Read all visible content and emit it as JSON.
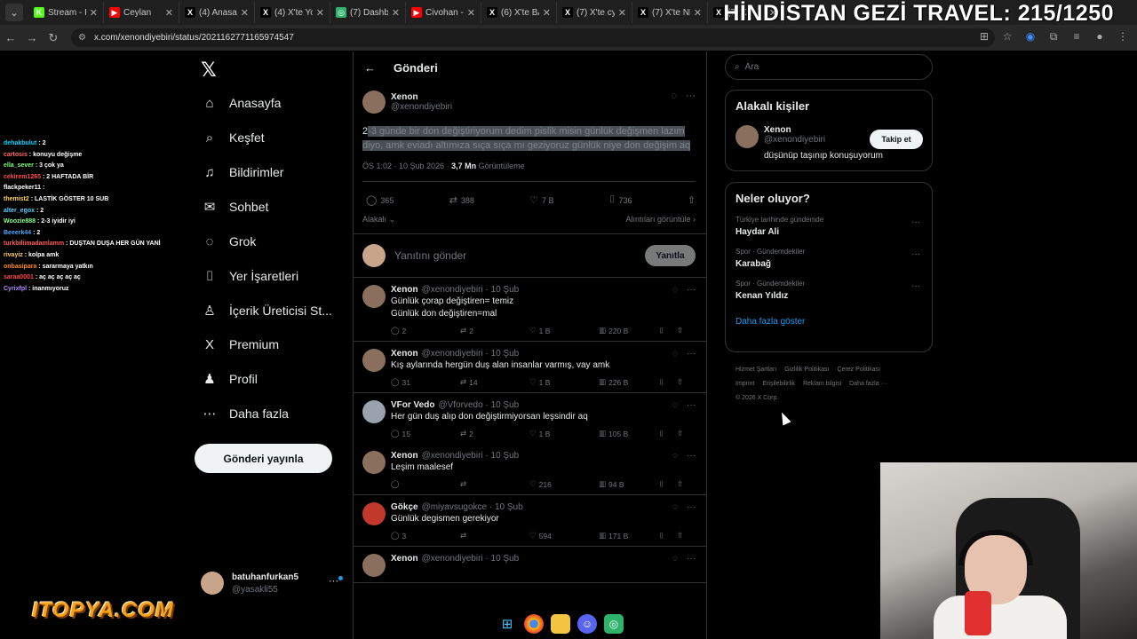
{
  "browser": {
    "tabs": [
      {
        "title": "Stream - K",
        "icon": "K",
        "color": "#53fc18"
      },
      {
        "title": "Ceylan",
        "icon": "▶",
        "color": "#ff0000"
      },
      {
        "title": "(4) Anasay",
        "icon": "X",
        "color": "#000000"
      },
      {
        "title": "(4) X'te Yo",
        "icon": "X",
        "color": "#000000"
      },
      {
        "title": "(7) Dashbo",
        "icon": "◎",
        "color": "#2fb36b"
      },
      {
        "title": "Civohan -",
        "icon": "▶",
        "color": "#ff0000"
      },
      {
        "title": "(6) X'te BA",
        "icon": "X",
        "color": "#000000"
      },
      {
        "title": "(7) X'te cy",
        "icon": "X",
        "color": "#000000"
      },
      {
        "title": "(7) X'te NE",
        "icon": "X",
        "color": "#000000"
      },
      {
        "title": "(7) X",
        "icon": "X",
        "color": "#000000"
      }
    ],
    "url": "x.com/xenondiyebiri/status/2021162771165974547"
  },
  "overlay_title": "HİNDİSTAN GEZİ TRAVEL: 215/1250",
  "chat": [
    {
      "user": "dehakbulut",
      "msg": "2",
      "color": "#00d4ff"
    },
    {
      "user": "cartosis",
      "msg": "konuyu değişme",
      "color": "#ff6b6b"
    },
    {
      "user": "ella_sever",
      "msg": "3 çok ya",
      "color": "#7cff7c"
    },
    {
      "user": "cekirem1265",
      "msg": "2 HAFTADA BİR",
      "color": "#ff4d4d"
    },
    {
      "user": "flackpeker11",
      "msg": "",
      "color": "#ffffff"
    },
    {
      "user": "themist2",
      "msg": "LASTİK GÖSTER 10 SUB",
      "color": "#ffd24d"
    },
    {
      "user": "alter_egox",
      "msg": "2",
      "color": "#66ccff"
    },
    {
      "user": "Woozie888",
      "msg": "2-3 iyidir iyi",
      "color": "#8cff8c"
    },
    {
      "user": "Beeerk44",
      "msg": "2",
      "color": "#4da6ff"
    },
    {
      "user": "turkbiliimadamlamm",
      "msg": "DUŞTAN DUŞA HER GÜN YANİ",
      "color": "#ff5c5c"
    },
    {
      "user": "rivayiz",
      "msg": "kolpa amk",
      "color": "#ffcc66"
    },
    {
      "user": "onbasipara",
      "msg": "sararmaya yatkın",
      "color": "#ff8c00"
    },
    {
      "user": "saraa0001",
      "msg": "aç aç aç aç aç",
      "color": "#ff4d4d"
    },
    {
      "user": "Cyrixfpl",
      "msg": "inanmıyoruz",
      "color": "#b48cff"
    }
  ],
  "nav": {
    "items": [
      {
        "label": "Anasayfa",
        "icon": "⌂"
      },
      {
        "label": "Keşfet",
        "icon": "⌕"
      },
      {
        "label": "Bildirimler",
        "icon": "♫"
      },
      {
        "label": "Sohbet",
        "icon": "✉"
      },
      {
        "label": "Grok",
        "icon": "◌"
      },
      {
        "label": "Yer İşaretleri",
        "icon": "⌷"
      },
      {
        "label": "İçerik Üreticisi St...",
        "icon": "♙"
      },
      {
        "label": "Premium",
        "icon": "X"
      },
      {
        "label": "Profil",
        "icon": "♟"
      },
      {
        "label": "Daha fazla",
        "icon": "⋯"
      }
    ],
    "notif_count": "7",
    "post_button": "Gönderi yayınla",
    "account_name": "batuhanfurkan5",
    "account_handle": "@yasakli55"
  },
  "main": {
    "header_title": "Gönderi",
    "tweet": {
      "name": "Xenon",
      "handle": "@xenondiyebiri",
      "text_prefix": "2",
      "text_highlight": "-3 günde bir don değiştiriyorum dedim pislik misin günlük değişmen lazım diyo, amk eviadı altımıza sıça sıça mı geziyoruz günlük niye don değişim aq",
      "time": "ÖS 1:02 · 10 Şub 2026 · ",
      "views": "3,7 Mn",
      "views_label": " Görüntüleme",
      "replies": "365",
      "reposts": "388",
      "likes": "7 B",
      "bookmarks": "736",
      "sort_label": "Alakalı",
      "quotes_label": "Alıntıları görüntüle"
    },
    "reply_placeholder": "Yanıtını gönder",
    "reply_button": "Yanıtla",
    "replies": [
      {
        "name": "Xenon",
        "handle": "@xenondiyebiri · 10 Şub",
        "text": "Günlük çorap değiştiren= temiz\nGünlük don değiştiren=mal",
        "r": "2",
        "rt": "2",
        "l": "1 B",
        "v": "220 B"
      },
      {
        "name": "Xenon",
        "handle": "@xenondiyebiri · 10 Şub",
        "text": "Kış aylarında hergün duş alan insanlar varmış, vay amk",
        "r": "31",
        "rt": "14",
        "l": "1 B",
        "v": "226 B"
      },
      {
        "name": "VFor Vedo",
        "handle": "@Vforvedo · 10 Şub",
        "text": "Her gün duş alıp don değiştirmiyorsan leşsindir aq",
        "r": "15",
        "rt": "2",
        "l": "1 B",
        "v": "105 B"
      },
      {
        "name": "Xenon",
        "handle": "@xenondiyebiri · 10 Şub",
        "text": "Leşim maalesef",
        "r": "",
        "rt": "",
        "l": "216",
        "v": "94 B"
      },
      {
        "name": "Gökçe",
        "handle": "@miyavsugokce · 10 Şub",
        "text": "Günlük degismen gerekiyor",
        "r": "3",
        "rt": "",
        "l": "594",
        "v": "171 B"
      },
      {
        "name": "Xenon",
        "handle": "@xenondiyebiri · 10 Şub",
        "text": "",
        "r": "",
        "rt": "",
        "l": "",
        "v": ""
      }
    ]
  },
  "right": {
    "search_placeholder": "Ara",
    "relevant_title": "Alakalı kişiler",
    "person_name": "Xenon",
    "person_handle": "@xenondiyebiri",
    "person_bio": "düşünüp taşınıp konuşuyorum",
    "follow_label": "Takip et",
    "trends_title": "Neler oluyor?",
    "trends": [
      {
        "cat": "Türkiye tarihinde gündemde",
        "name": "Haydar Ali"
      },
      {
        "cat": "Spor · Gündemdekiler",
        "name": "Karabağ"
      },
      {
        "cat": "Spor · Gündemdekiler",
        "name": "Kenan Yıldız"
      }
    ],
    "show_more": "Daha fazla göster",
    "footer": [
      "Hizmet Şartları",
      "Gizlilik Politikası",
      "Çerez Politikası",
      "Imprint",
      "Erişilebilirlik",
      "Reklam bilgisi",
      "Daha fazla ···",
      "© 2026 X Corp."
    ]
  },
  "sponsor": "ITOPYA.COM"
}
